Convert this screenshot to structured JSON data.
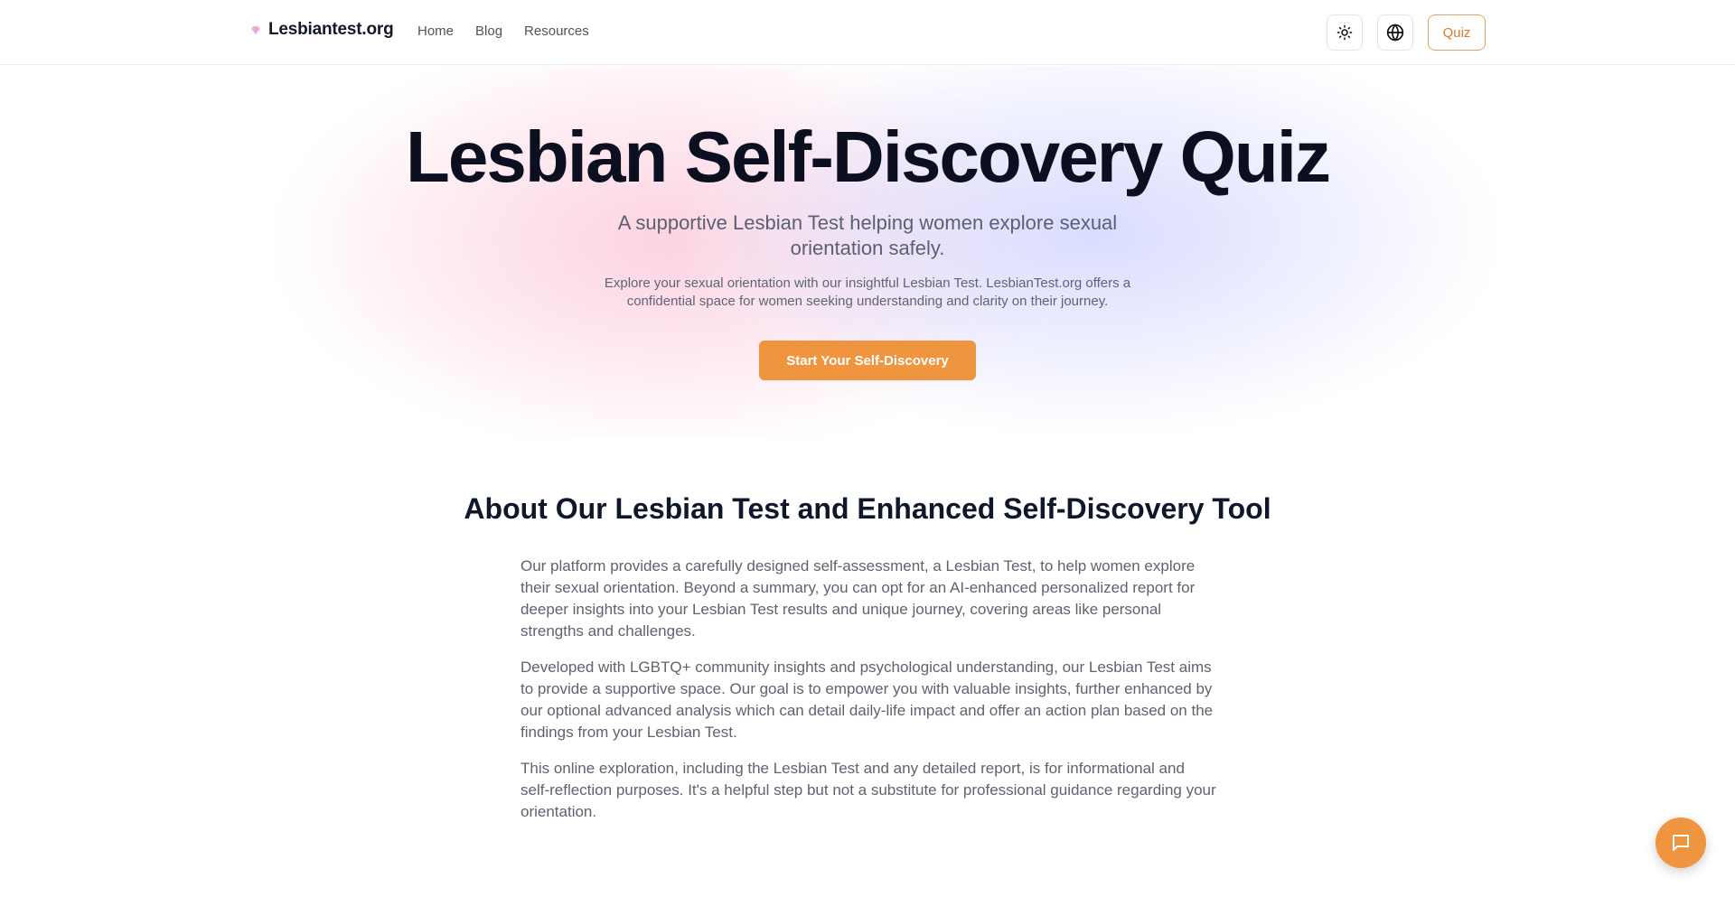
{
  "nav": {
    "brand": "Lesbiantest.org",
    "links": [
      "Home",
      "Blog",
      "Resources"
    ],
    "quiz_label": "Quiz",
    "theme_icon": "sun-icon",
    "language_icon": "globe-icon"
  },
  "hero": {
    "title": "Lesbian Self-Discovery Quiz",
    "subtitle": "A supportive Lesbian Test helping women explore sexual orientation safely.",
    "description": "Explore your sexual orientation with our insightful Lesbian Test. LesbianTest.org offers a confidential space for women seeking understanding and clarity on their journey.",
    "cta_label": "Start Your Self-Discovery"
  },
  "about": {
    "title": "About Our Lesbian Test and Enhanced Self-Discovery Tool",
    "paragraphs": [
      "Our platform provides a carefully designed self-assessment, a Lesbian Test, to help women explore their sexual orientation. Beyond a summary, you can opt for an AI-enhanced personalized report for deeper insights into your Lesbian Test results and unique journey, covering areas like personal strengths and challenges.",
      "Developed with LGBTQ+ community insights and psychological understanding, our Lesbian Test aims to provide a supportive space. Our goal is to empower you with valuable insights, further enhanced by our optional advanced analysis which can detail daily-life impact and offer an action plan based on the findings from your Lesbian Test.",
      "This online exploration, including the Lesbian Test and any detailed report, is for informational and self-reflection purposes. It's a helpful step but not a substitute for professional guidance regarding your orientation."
    ]
  },
  "chat_icon": "chat-icon",
  "colors": {
    "accent": "#ef9540",
    "quiz_outline": "#e0a064",
    "title": "#0b0f1f",
    "body_text": "#5f6370"
  }
}
